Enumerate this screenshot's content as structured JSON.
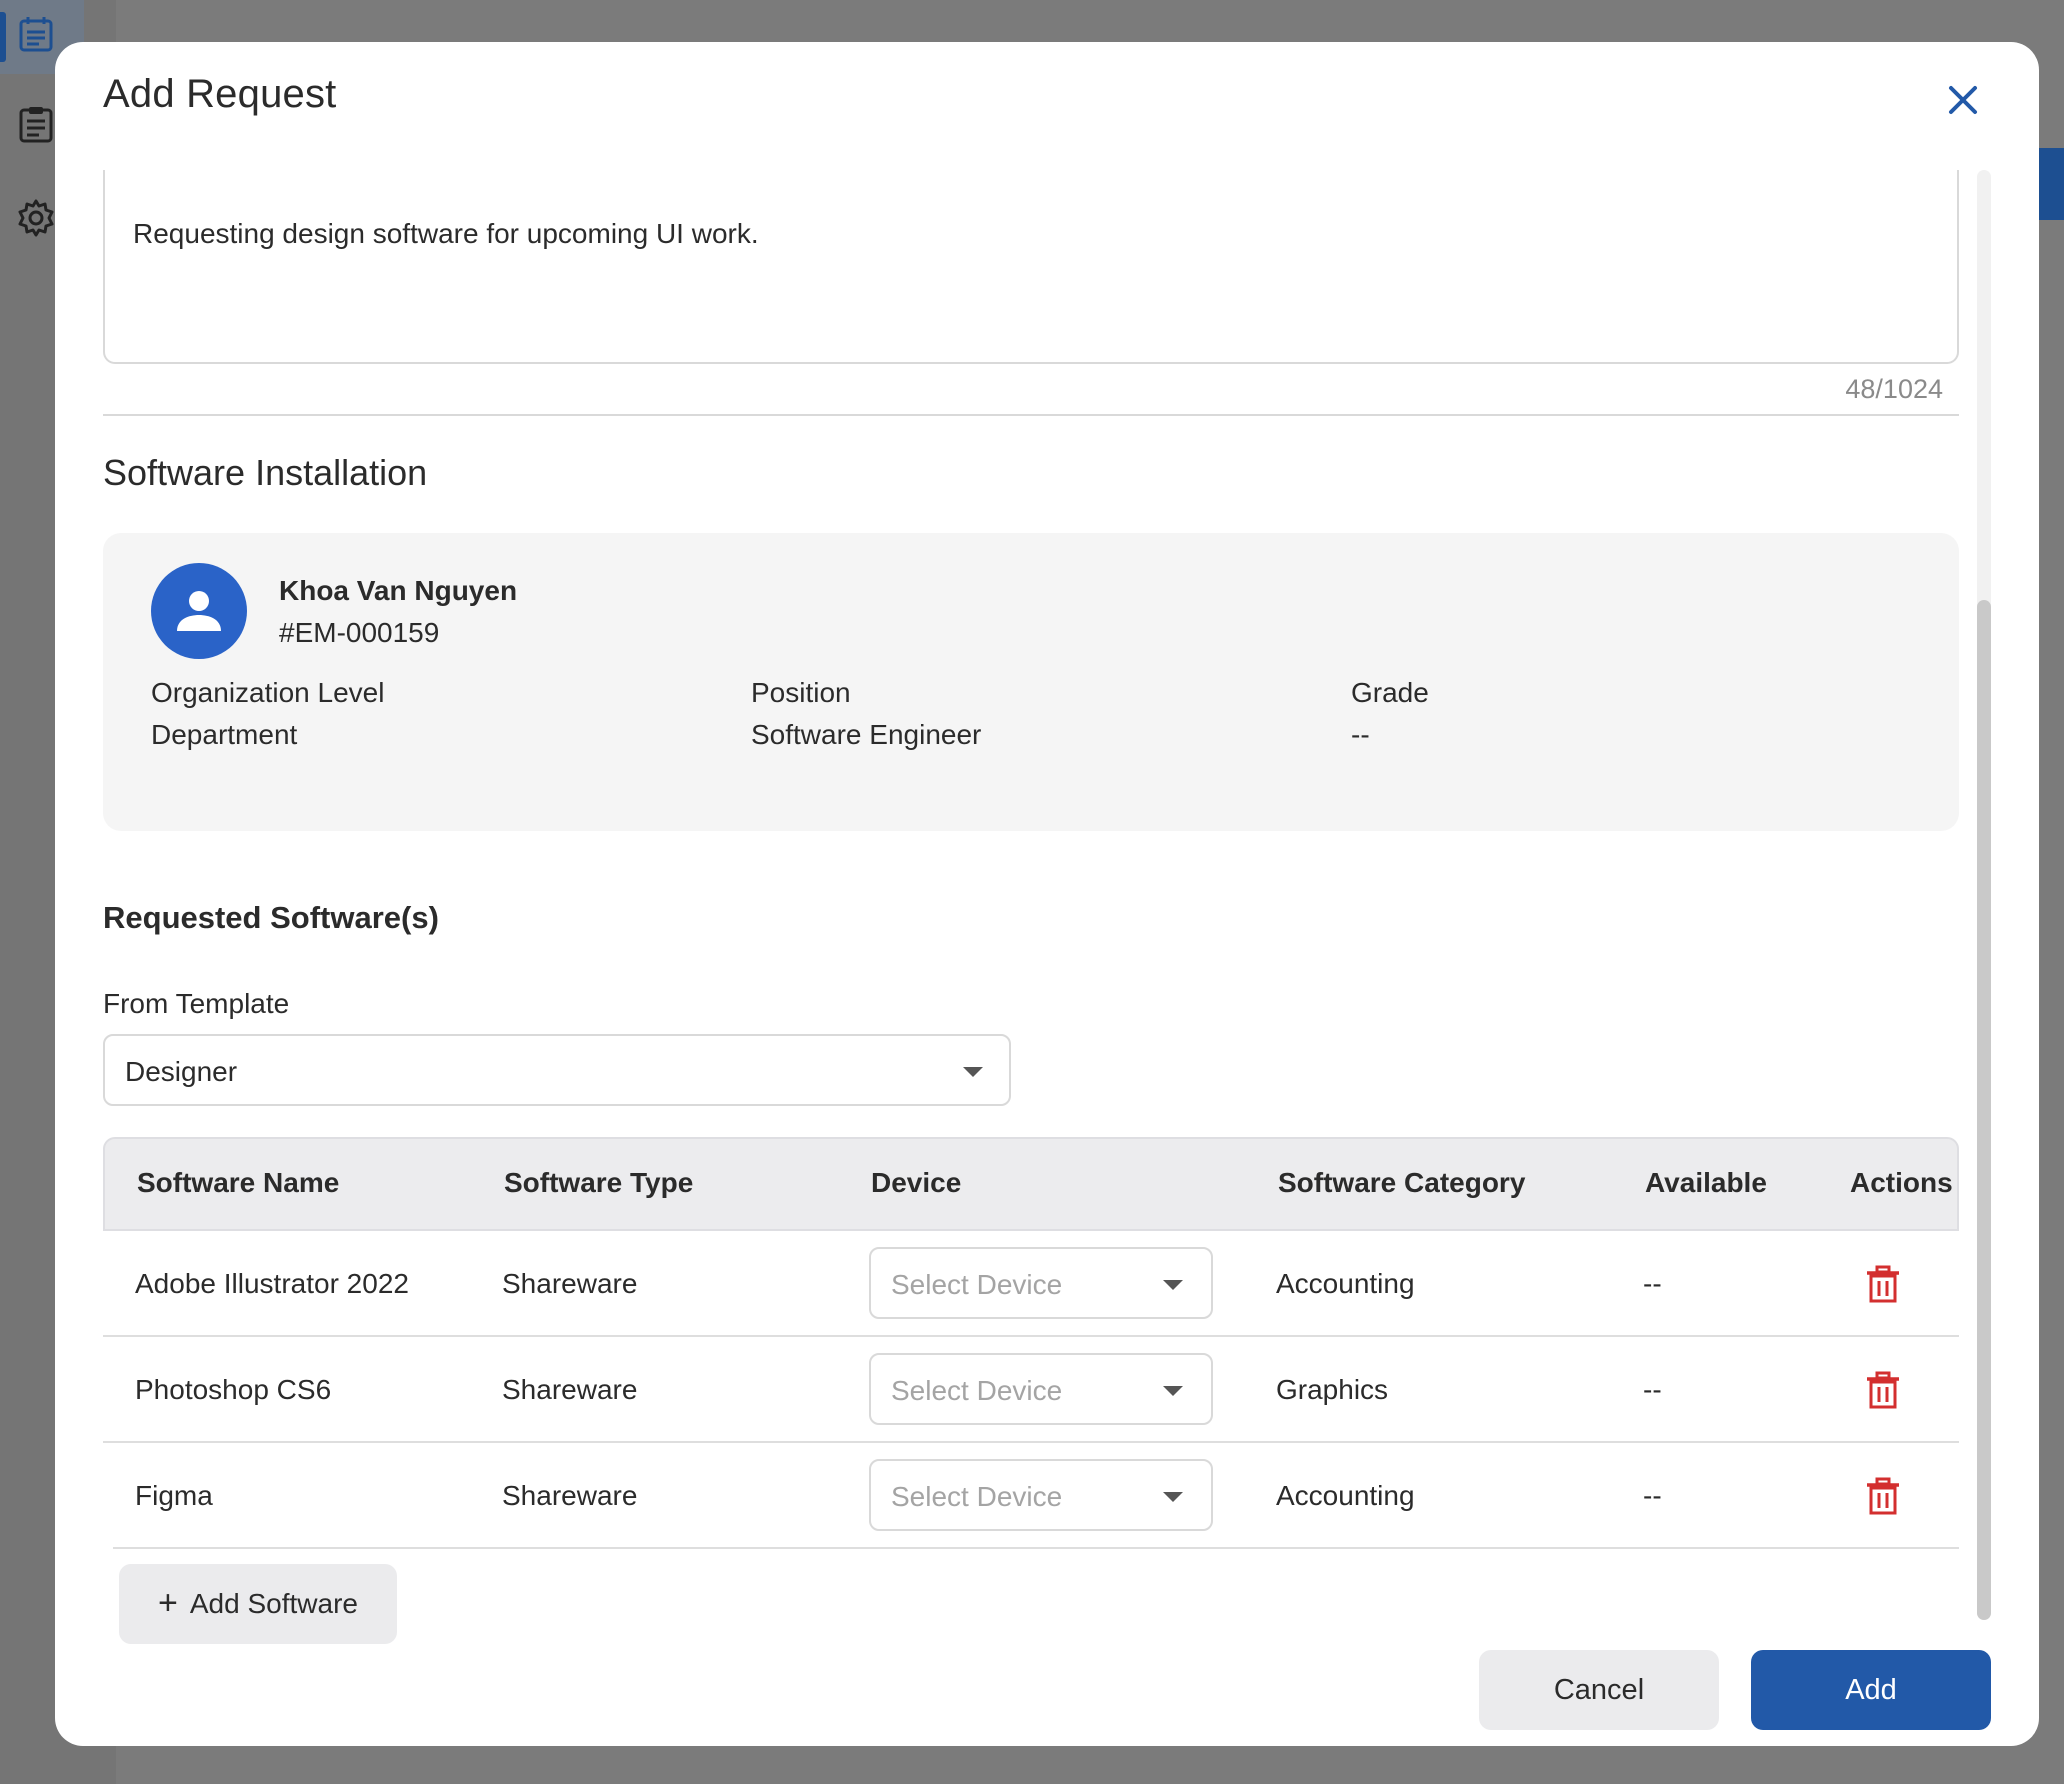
{
  "modal": {
    "title": "Add Request",
    "close_icon": "close-icon"
  },
  "description": {
    "text": "Requesting design software for upcoming UI work.",
    "char_count": "48/1024"
  },
  "section": {
    "title": "Software Installation"
  },
  "employee": {
    "avatar_icon": "person-icon",
    "name": "Khoa Van Nguyen",
    "id": "#EM-000159",
    "fields": [
      {
        "label": "Organization Level",
        "value": "Department"
      },
      {
        "label": "Position",
        "value": "Software Engineer"
      },
      {
        "label": "Grade",
        "value": "--"
      }
    ]
  },
  "requested": {
    "title": "Requested Software(s)",
    "template_label": "From Template",
    "template_value": "Designer"
  },
  "table": {
    "headers": [
      "Software Name",
      "Software Type",
      "Device",
      "Software Category",
      "Available",
      "Actions"
    ],
    "rows": [
      {
        "name": "Adobe Illustrator 2022",
        "type": "Shareware",
        "device_placeholder": "Select Device",
        "category": "Accounting",
        "available": "--"
      },
      {
        "name": "Photoshop CS6",
        "type": "Shareware",
        "device_placeholder": "Select Device",
        "category": "Graphics",
        "available": "--"
      },
      {
        "name": "Figma",
        "type": "Shareware",
        "device_placeholder": "Select Device",
        "category": "Accounting",
        "available": "--"
      }
    ],
    "delete_icon": "trash-icon"
  },
  "buttons": {
    "add_software": "Add Software",
    "cancel": "Cancel",
    "add": "Add"
  },
  "colors": {
    "primary": "#2259a8",
    "avatar": "#2a63c8",
    "danger": "#d32f2f"
  }
}
